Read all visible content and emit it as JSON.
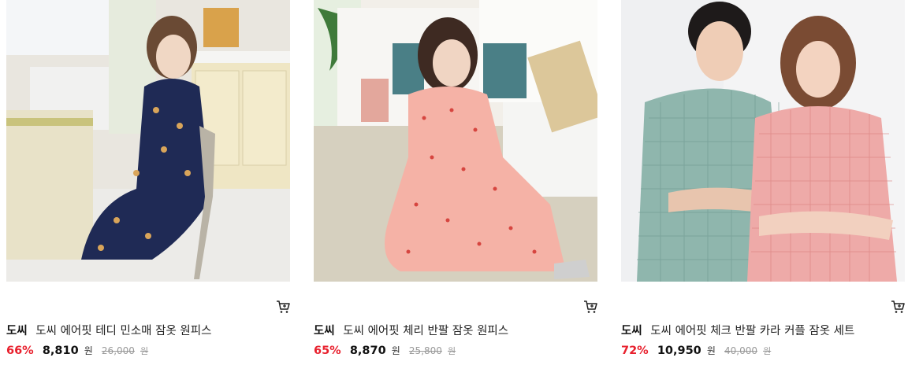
{
  "products": [
    {
      "image_alt": "",
      "brand": "도씨",
      "name": "도씨 에어핏 테디 민소매 잠옷 원피스",
      "discount": "66%",
      "price": "8,810",
      "currency": "원",
      "original_price": "26,000",
      "original_currency": "원",
      "cart_icon": "cart-icon"
    },
    {
      "image_alt": "",
      "brand": "도씨",
      "name": "도씨 에어핏 체리 반팔 잠옷 원피스",
      "discount": "65%",
      "price": "8,870",
      "currency": "원",
      "original_price": "25,800",
      "original_currency": "원",
      "cart_icon": "cart-icon"
    },
    {
      "image_alt": "",
      "brand": "도씨",
      "name": "도씨 에어핏 체크 반팔 카라 커플 잠옷 세트",
      "discount": "72%",
      "price": "10,950",
      "currency": "원",
      "original_price": "40,000",
      "original_currency": "원",
      "cart_icon": "cart-icon"
    }
  ],
  "colors": {
    "discount": "#e8202d",
    "price": "#111111",
    "original_price": "#999999"
  }
}
